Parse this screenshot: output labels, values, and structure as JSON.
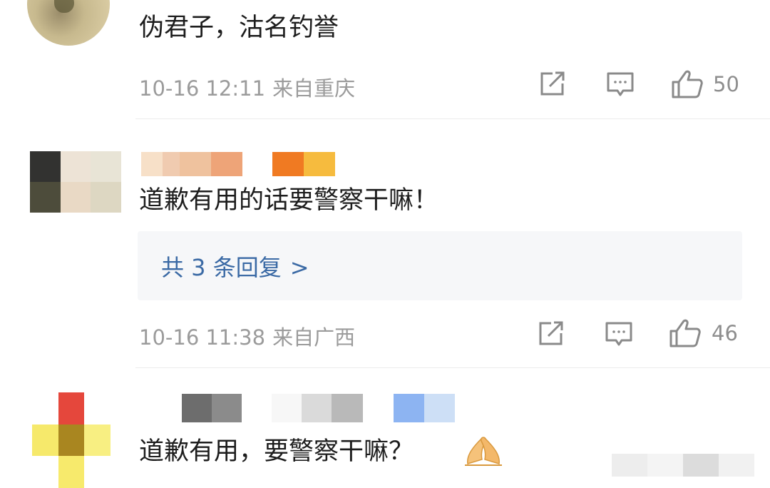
{
  "comments": [
    {
      "text": "伪君子，沽名钓誉",
      "time": "10-16 12:11",
      "location": "来自重庆",
      "likes": "50"
    },
    {
      "text": "道歉有用的话要警察干嘛！",
      "replies_label": "共 3 条回复",
      "replies_chevron": ">",
      "time": "10-16 11:38",
      "location": "来自广西",
      "likes": "46"
    },
    {
      "text": "道歉有用，要警察干嘛？"
    }
  ],
  "icons": [
    "share-icon",
    "comment-icon",
    "like-icon",
    "folded-hands-emoji"
  ],
  "colors": {
    "meta_text": "#9b9b9b",
    "link": "#3b6aa5",
    "reply_bg": "#f6f7f9",
    "icon": "#8a8a8a"
  }
}
